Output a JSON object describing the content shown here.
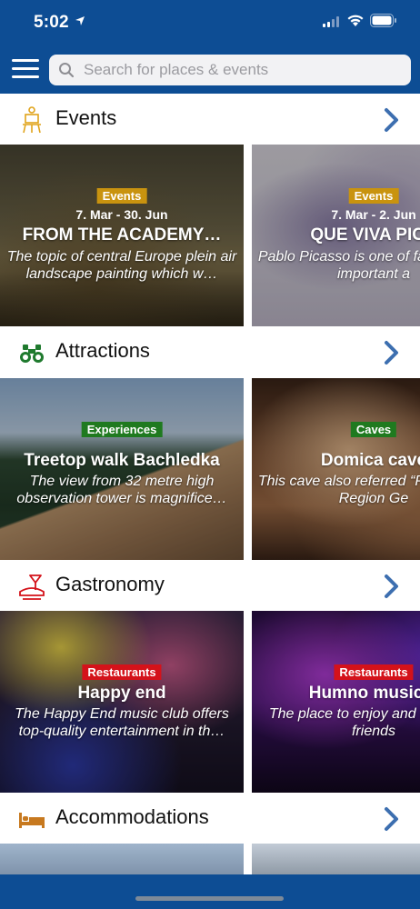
{
  "status_bar": {
    "time": "5:02"
  },
  "search": {
    "placeholder": "Search for places & events"
  },
  "sections": [
    {
      "title": "Events",
      "cards": [
        {
          "badge": "Events",
          "date": "7. Mar - 30. Jun",
          "title": "FROM THE ACADEMY…",
          "description": "The topic of central Europe plein air landscape painting which w…"
        },
        {
          "badge": "Events",
          "date": "7. Mar - 2. Jun",
          "title": "QUE VIVA PICA",
          "description": "Pablo Picasso is one of famous and important a"
        }
      ]
    },
    {
      "title": "Attractions",
      "cards": [
        {
          "badge": "Experiences",
          "title": "Treetop walk Bachledka",
          "description": "The view from 32 metre high observation tower is magnifice…"
        },
        {
          "badge": "Caves",
          "title": "Domica cave",
          "description": "This cave also referred “Pride of the Region Ge"
        }
      ]
    },
    {
      "title": "Gastronomy",
      "cards": [
        {
          "badge": "Restaurants",
          "title": "Happy end",
          "description": "The Happy End music club offers top-quality entertainment in th…"
        },
        {
          "badge": "Restaurants",
          "title": "Humno music p",
          "description": "The place to enjoy and with your friends"
        }
      ]
    },
    {
      "title": "Accommodations"
    }
  ],
  "colors": {
    "brand_blue": "#0d4d94",
    "events_badge": "#c9930f",
    "experiences_badge": "#1f7a1f",
    "restaurants_badge": "#d4121a",
    "chevron": "#3d6fb0"
  }
}
